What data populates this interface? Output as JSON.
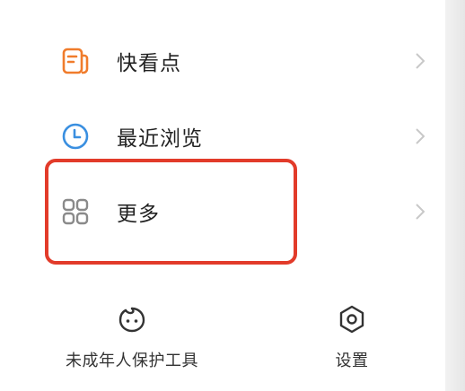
{
  "menu": {
    "items": [
      {
        "label": "快看点",
        "icon": "news-doc-icon",
        "icon_color": "#f07c2c"
      },
      {
        "label": "最近浏览",
        "icon": "clock-icon",
        "icon_color": "#3a8fe0"
      },
      {
        "label": "更多",
        "icon": "grid-icon",
        "icon_color": "#8a8a8a"
      }
    ]
  },
  "tools": {
    "minor_protection": {
      "label": "未成年人保护工具",
      "icon": "child-face-icon"
    },
    "settings": {
      "label": "设置",
      "icon": "settings-hexagon-icon"
    }
  },
  "highlight_color": "#e23b2a"
}
